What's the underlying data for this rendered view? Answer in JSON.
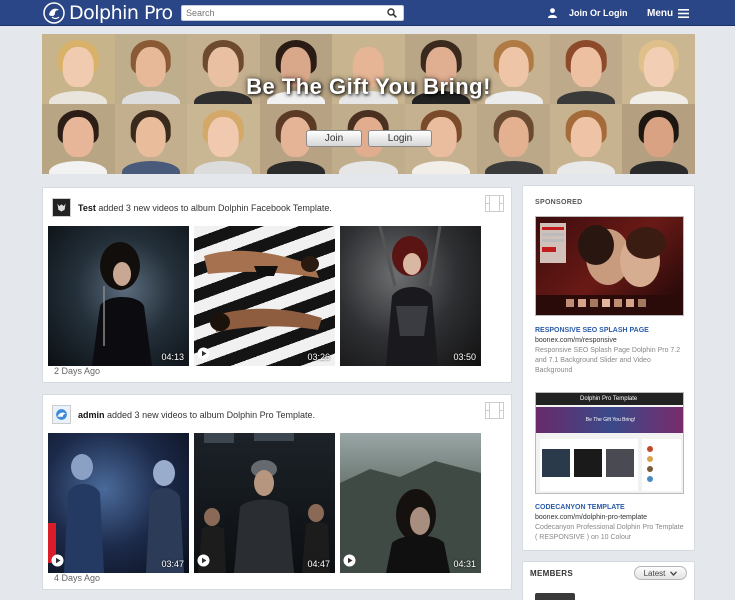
{
  "header": {
    "brand": "Dolphin Pro",
    "search_placeholder": "Search",
    "login_label": "Join Or Login",
    "menu_label": "Menu",
    "bar_color": "#2b4686"
  },
  "hero": {
    "title": "Be The Gift You Bring!",
    "join_label": "Join",
    "login_label": "Login"
  },
  "feed": [
    {
      "user": "Test",
      "action": "added 3 new videos to album Dolphin Facebook Template.",
      "time": "2 Days Ago",
      "videos": [
        {
          "duration": "04:13",
          "play": false
        },
        {
          "duration": "03:26",
          "play": true
        },
        {
          "duration": "03:50",
          "play": false
        }
      ]
    },
    {
      "user": "admin",
      "action": "added 3 new videos to album Dolphin Pro Template.",
      "time": "4 Days Ago",
      "videos": [
        {
          "duration": "03:47",
          "play": true
        },
        {
          "duration": "04:47",
          "play": true
        },
        {
          "duration": "04:31",
          "play": true
        }
      ]
    }
  ],
  "sidebar": {
    "sponsored_label": "SPONSORED",
    "ads": [
      {
        "title": "RESPONSIVE SEO SPLASH PAGE",
        "url": "boonex.com/m/responsive",
        "desc": "Responsive SEO Splash Page Dolphin Pro 7.2 and 7.1 Background Slider and Video Background"
      },
      {
        "title": "CODECANYON TEMPLATE",
        "url": "boonex.com/m/dolphin-pro-template",
        "desc": "Codecanyon Professional Dolphin Pro Template ( RESPONSIVE ) on 10 Colour",
        "mini_brand": "Dolphin Pro Template",
        "mini_title": "Be The Gift You Bring!"
      }
    ],
    "members_label": "MEMBERS",
    "members_sort": "Latest"
  }
}
